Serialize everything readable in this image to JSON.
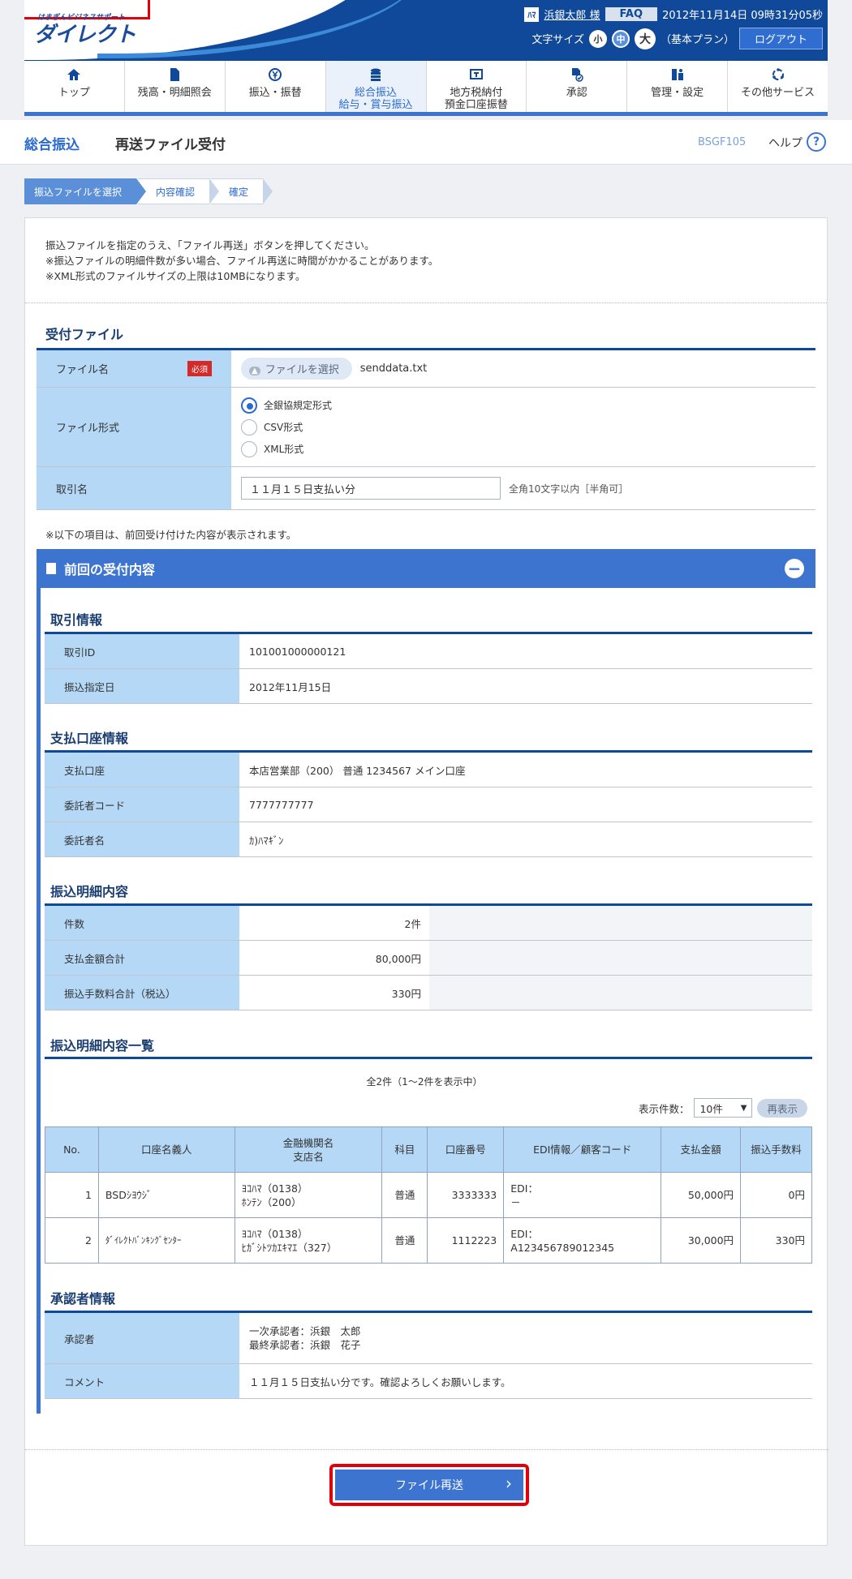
{
  "header": {
    "logo_sub": "はまぎんビジネスサポート",
    "logo": "ダイレクト",
    "user_icon": "ﾊﾏ",
    "user_name": "浜銀太郎 様",
    "faq": "FAQ",
    "datetime": "2012年11月14日 09時31分05秒",
    "font_size_label": "文字サイズ",
    "fs_small": "小",
    "fs_mid": "中",
    "fs_large": "大",
    "plan": "（基本プラン）",
    "logout": "ログアウト"
  },
  "nav": {
    "items": [
      {
        "label1": "トップ",
        "label2": "",
        "icon": "home-icon"
      },
      {
        "label1": "残高・明細照会",
        "label2": "",
        "icon": "document-icon"
      },
      {
        "label1": "振込・振替",
        "label2": "",
        "icon": "yen-icon"
      },
      {
        "label1": "総合振込",
        "label2": "給与・賞与振込",
        "icon": "coins-icon"
      },
      {
        "label1": "地方税納付",
        "label2": "預金口座振替",
        "icon": "tax-icon"
      },
      {
        "label1": "承認",
        "label2": "",
        "icon": "approve-icon"
      },
      {
        "label1": "管理・設定",
        "label2": "",
        "icon": "settings-icon"
      },
      {
        "label1": "その他サービス",
        "label2": "",
        "icon": "services-icon"
      }
    ]
  },
  "page": {
    "category": "総合振込",
    "title": "再送ファイル受付",
    "code": "BSGF105",
    "help": "ヘルプ",
    "help_icon": "?"
  },
  "steps": [
    "振込ファイルを選択",
    "内容確認",
    "確定"
  ],
  "intro": [
    "振込ファイルを指定のうえ、「ファイル再送」ボタンを押してください。",
    "※振込ファイルの明細件数が多い場合、ファイル再送に時間がかかることがあります。",
    "※XML形式のファイルサイズの上限は10MBになります。"
  ],
  "upload": {
    "heading": "受付ファイル",
    "file_label": "ファイル名",
    "required": "必須",
    "file_button": "ファイルを選択",
    "file_name": "senddata.txt",
    "format_label": "ファイル形式",
    "formats": [
      "全銀協規定形式",
      "CSV形式",
      "XML形式"
    ],
    "trade_label": "取引名",
    "trade_value": "１１月１５日支払い分",
    "trade_hint": "全角10文字以内［半角可］"
  },
  "note_prev": "※以下の項目は、前回受け付けた内容が表示されます。",
  "prev": {
    "title": "前回の受付内容",
    "minus": "−",
    "trade_heading": "取引情報",
    "trade_id_label": "取引ID",
    "trade_id": "101001000000121",
    "date_label": "振込指定日",
    "date": "2012年11月15日",
    "acct_heading": "支払口座情報",
    "acct_label": "支払口座",
    "acct": "本店営業部（200） 普通 1234567 メイン口座",
    "code_label": "委託者コード",
    "code": "7777777777",
    "name_label": "委託者名",
    "name": "ｶ)ﾊﾏｷﾞﾝ",
    "detail_heading": "振込明細内容",
    "count_label": "件数",
    "count": "2件",
    "total_label": "支払金額合計",
    "total": "80,000円",
    "fee_label": "振込手数料合計（税込）",
    "fee": "330円",
    "list_heading": "振込明細内容一覧",
    "list_count": "全2件（1～2件を表示中）",
    "disp_label": "表示件数：",
    "disp_value": "10件",
    "redisp": "再表示",
    "cols": [
      "No.",
      "口座名義人",
      "金融機関名",
      "支店名",
      "科目",
      "口座番号",
      "EDI情報／顧客コード",
      "支払金額",
      "振込手数料"
    ],
    "rows": [
      {
        "no": "1",
        "holder": "BSDｼﾖｳｼﾞ",
        "bank": "ﾖｺﾊﾏ（0138）",
        "branch": "ﾎﾝﾃﾝ（200）",
        "kind": "普通",
        "acct": "3333333",
        "edi1": "EDI：",
        "edi2": "－",
        "amount": "50,000円",
        "fee": "0円"
      },
      {
        "no": "2",
        "holder": "ﾀﾞｲﾚｸﾄﾊﾞﾝｷﾝｸﾞｾﾝﾀｰ",
        "bank": "ﾖｺﾊﾏ（0138）",
        "branch": "ﾋｶﾞｼﾄﾂｶｴｷﾏｴ（327）",
        "kind": "普通",
        "acct": "1112223",
        "edi1": "EDI：",
        "edi2": "A123456789012345",
        "amount": "30,000円",
        "fee": "330円"
      }
    ],
    "approver_heading": "承認者情報",
    "approver_label": "承認者",
    "approver1": "一次承認者：浜銀　太郎",
    "approver2": "最終承認者：浜銀　花子",
    "comment_label": "コメント",
    "comment": "１１月１５日支払い分です。確認よろしくお願いします。"
  },
  "send_button": "ファイル再送",
  "send_arrow": "›"
}
